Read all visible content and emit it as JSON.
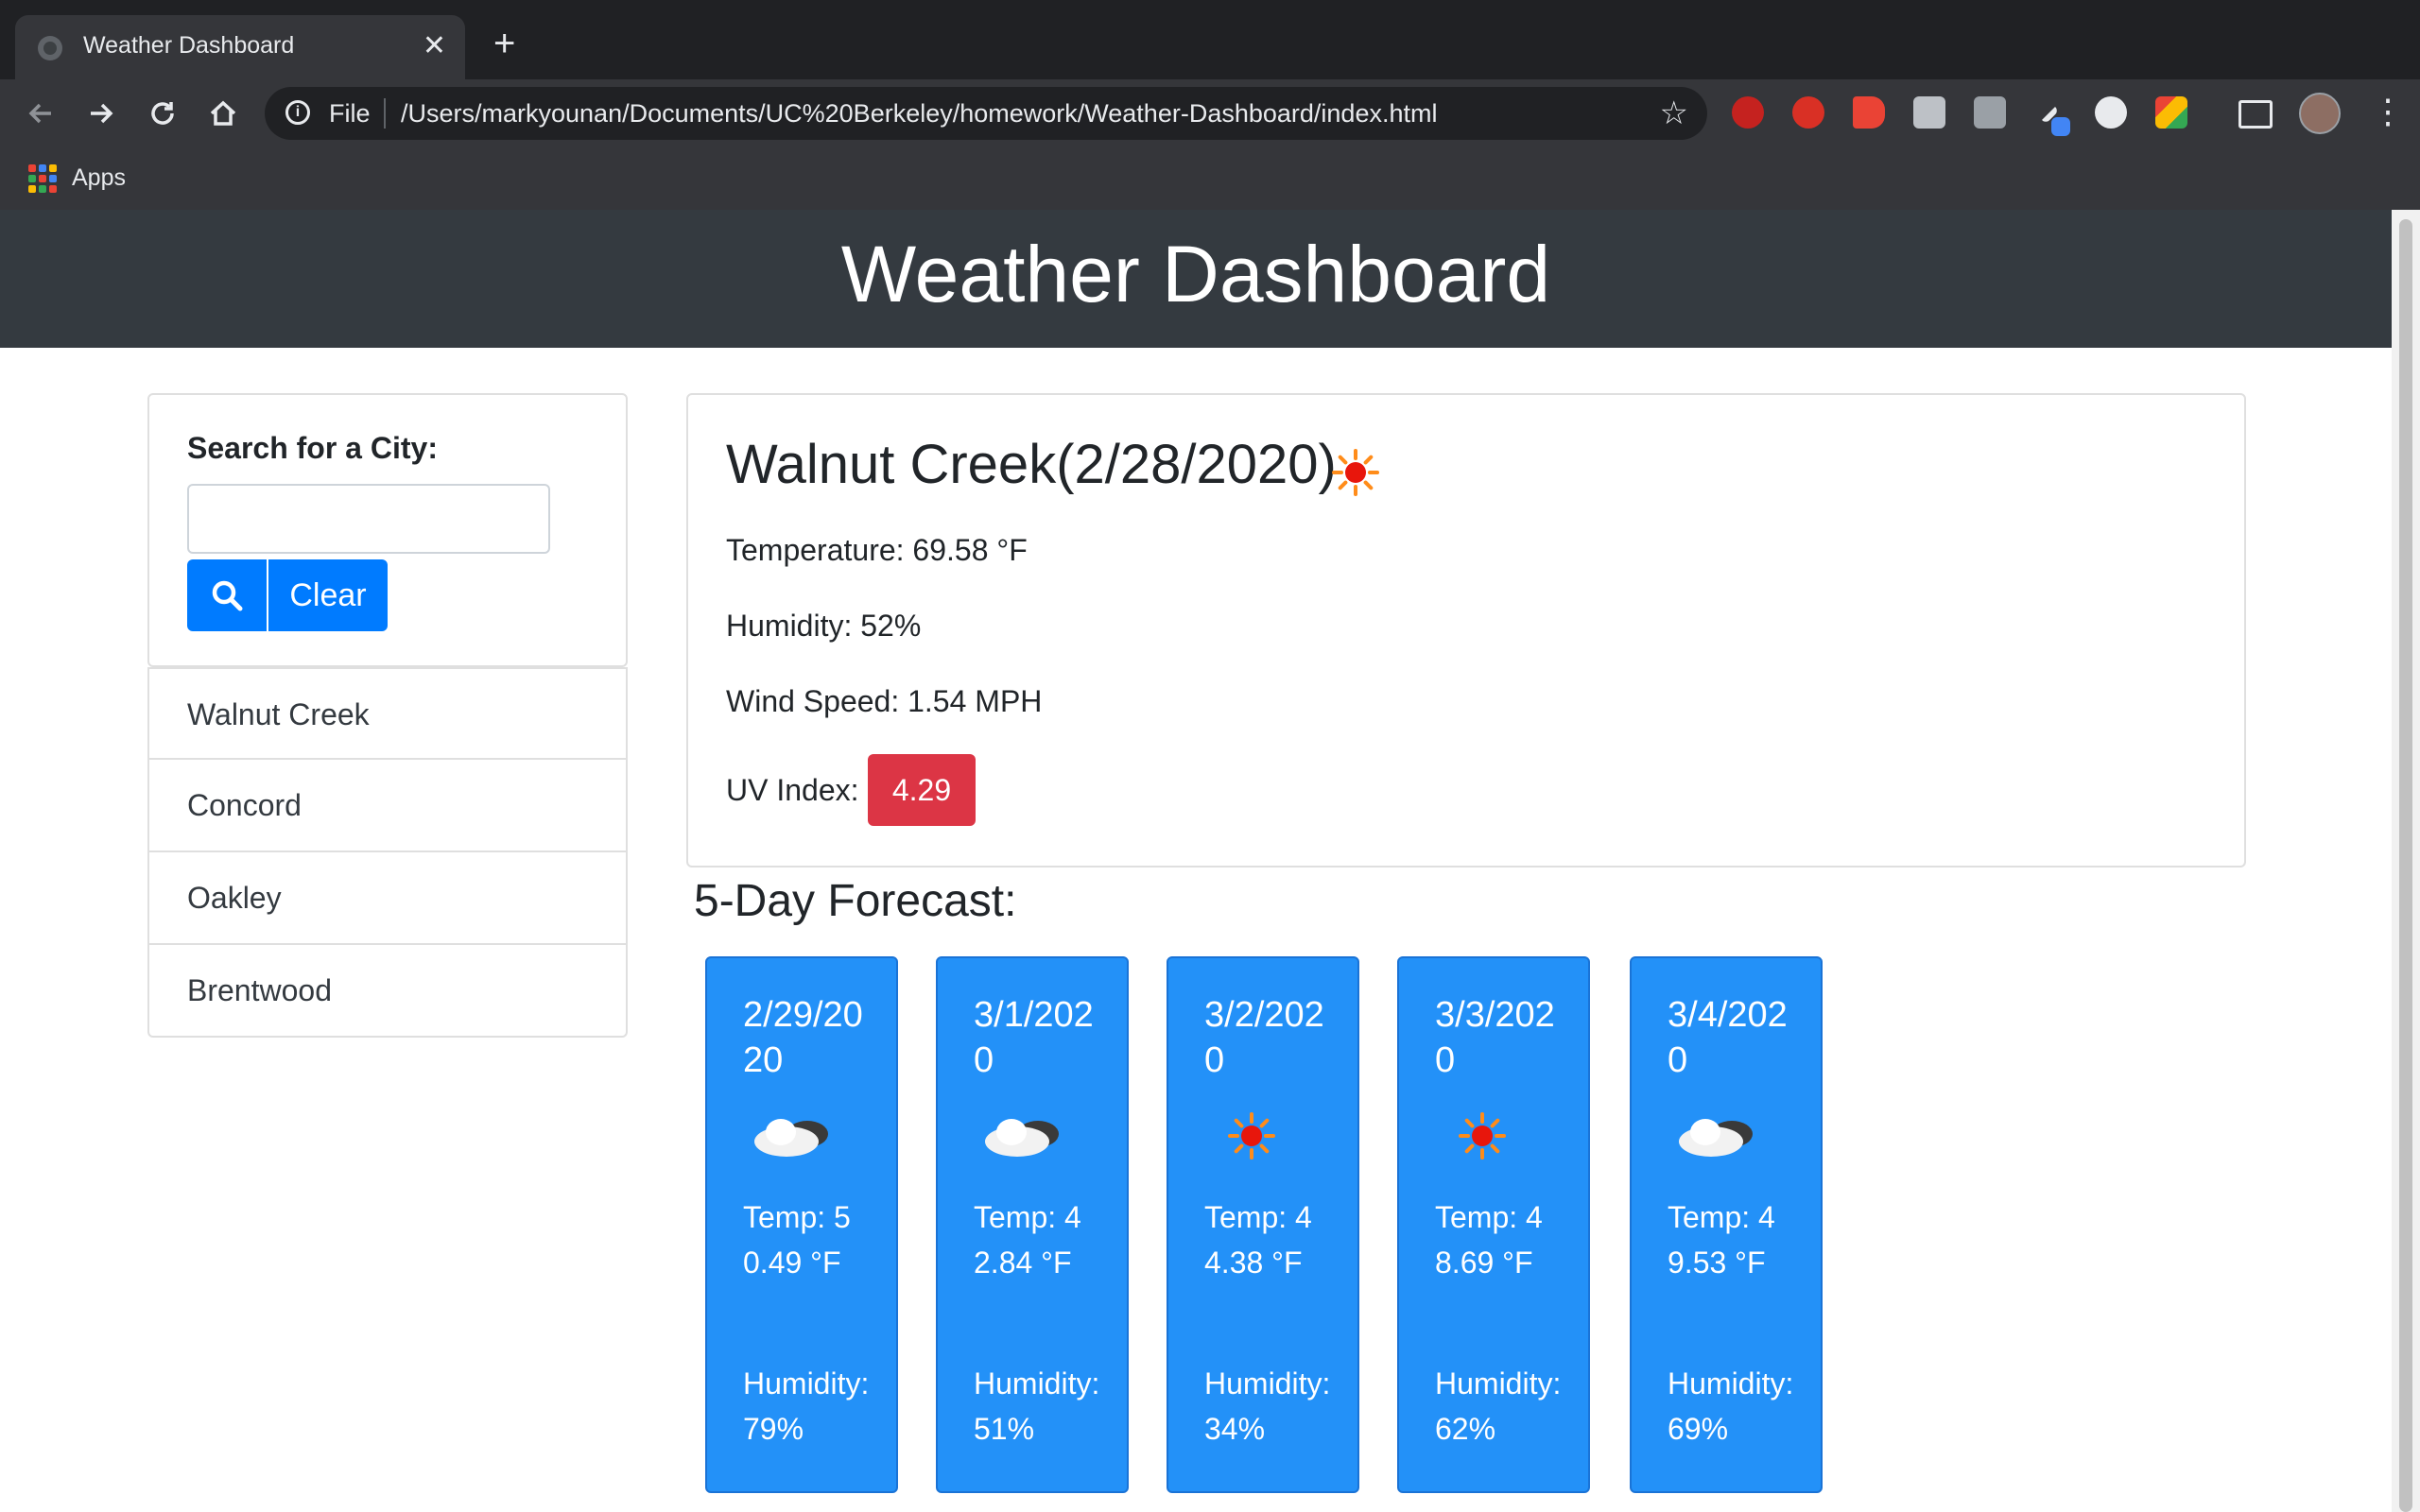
{
  "browser": {
    "tab_title": "Weather Dashboard",
    "tab_close": "✕",
    "new_tab": "+",
    "omnibox_scheme": "File",
    "url": "/Users/markyounan/Documents/UC%20Berkeley/homework/Weather-Dashboard/index.html",
    "bookmarks_apps_label": "Apps"
  },
  "header": {
    "title": "Weather Dashboard"
  },
  "search": {
    "label": "Search for a City:",
    "input_value": "",
    "search_icon": "search-icon",
    "clear_label": "Clear"
  },
  "cities": [
    "Walnut Creek",
    "Concord",
    "Oakley",
    "Brentwood"
  ],
  "current": {
    "heading": "Walnut Creek(2/28/2020)",
    "icon": "sun-icon",
    "temperature": "Temperature: 69.58 °F",
    "humidity": "Humidity: 52%",
    "wind": "Wind Speed: 1.54 MPH",
    "uv_label": "UV Index:",
    "uv_value": "4.29",
    "uv_color": "#dc3545"
  },
  "forecast": {
    "title": "5-Day Forecast:",
    "card_color": "#2391f8",
    "days": [
      {
        "date": "2/29/2020",
        "icon": "cloud-icon",
        "temp": "Temp: 50.49 °F",
        "humidity": "Humidity: 79%"
      },
      {
        "date": "3/1/2020",
        "icon": "cloud-icon",
        "temp": "Temp: 42.84 °F",
        "humidity": "Humidity: 51%"
      },
      {
        "date": "3/2/2020",
        "icon": "sun-icon",
        "temp": "Temp: 44.38 °F",
        "humidity": "Humidity: 34%"
      },
      {
        "date": "3/3/2020",
        "icon": "sun-icon",
        "temp": "Temp: 48.69 °F",
        "humidity": "Humidity: 62%"
      },
      {
        "date": "3/4/2020",
        "icon": "cloud-icon",
        "temp": "Temp: 49.53 °F",
        "humidity": "Humidity: 69%"
      }
    ]
  }
}
